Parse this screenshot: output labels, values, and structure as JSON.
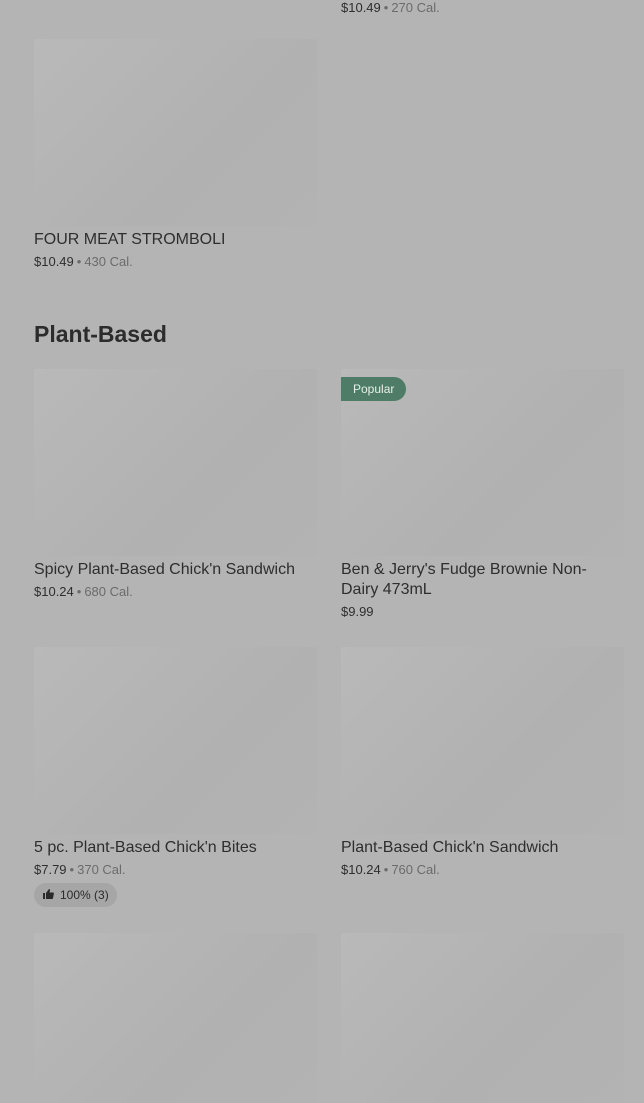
{
  "top_partial": {
    "price": "$10.49",
    "calories": "270 Cal."
  },
  "four_meat": {
    "name": "FOUR MEAT STROMBOLI",
    "price": "$10.49",
    "calories": "430 Cal."
  },
  "section": {
    "title": "Plant-Based"
  },
  "items": [
    {
      "name": "Spicy Plant-Based Chick'n Sandwich",
      "price": "$10.24",
      "calories": "680 Cal."
    },
    {
      "badge": "Popular",
      "name": "Ben & Jerry's Fudge Brownie Non-Dairy 473mL",
      "price": "$9.99"
    },
    {
      "name": "5 pc. Plant-Based Chick'n Bites",
      "price": "$7.79",
      "calories": "370 Cal.",
      "rating": "100% (3)"
    },
    {
      "name": "Plant-Based Chick'n Sandwich",
      "price": "$10.24",
      "calories": "760 Cal."
    }
  ],
  "icons": {
    "rating": "thumbs-up-icon"
  }
}
